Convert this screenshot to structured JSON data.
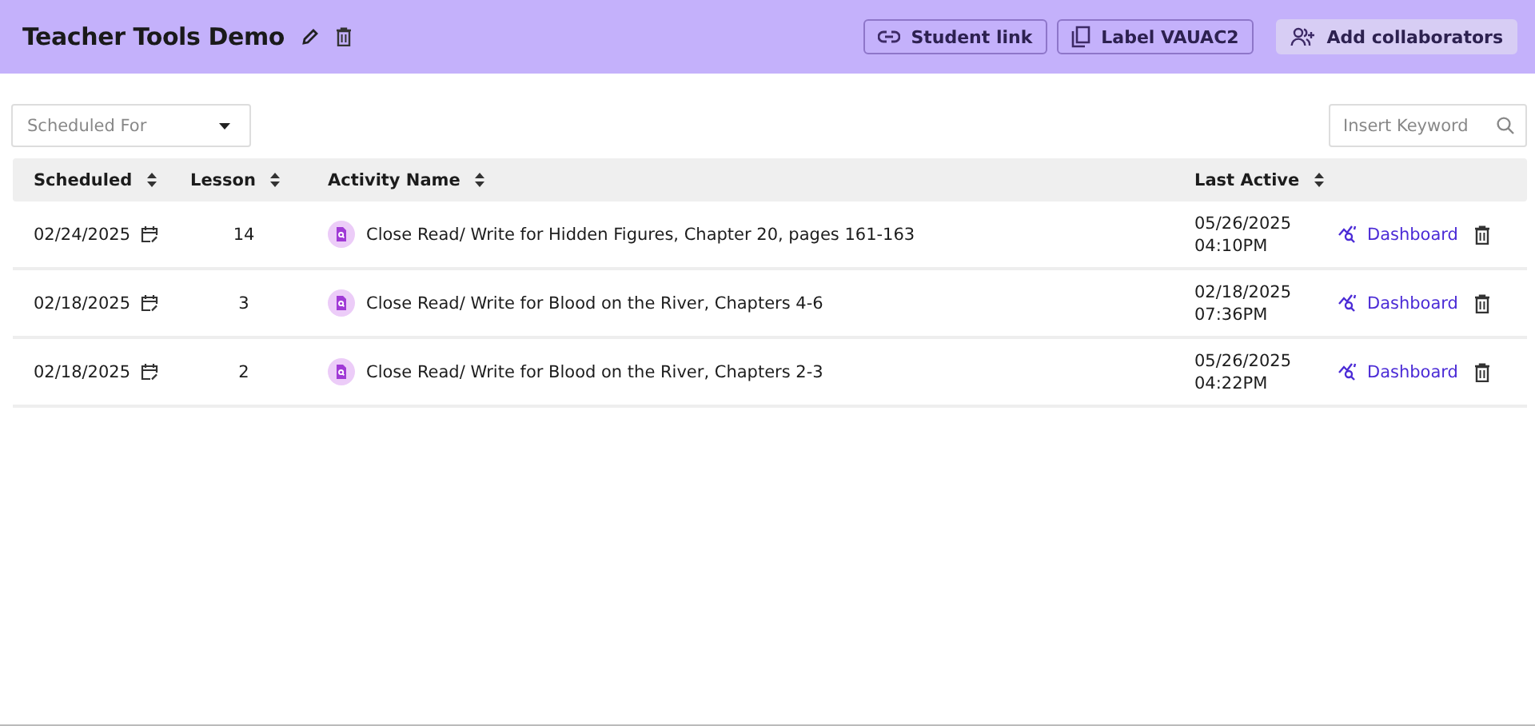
{
  "header": {
    "title": "Teacher Tools Demo",
    "buttons": [
      {
        "kind": "link",
        "label": "Student link"
      },
      {
        "kind": "copy",
        "label": "Label **VAUAC2**"
      },
      {
        "kind": "collab",
        "label": "Add collaborators"
      }
    ]
  },
  "filter": {
    "placeholder": "Scheduled For"
  },
  "search": {
    "placeholder": "Insert Keyword"
  },
  "table": {
    "columns": [
      "Scheduled",
      "Lesson",
      "Activity Name",
      "Last Active"
    ],
    "rows": [
      {
        "scheduled": "02/24/2025",
        "lesson": "14",
        "activity": "Close Read/ Write for Hidden Figures, Chapter 20, pages 161-163",
        "last_active": [
          "05/26/2025",
          "04:10PM"
        ],
        "action": "Dashboard"
      },
      {
        "scheduled": "02/18/2025",
        "lesson": "3",
        "activity": "Close Read/ Write for Blood on the River, Chapters 4-6",
        "last_active": [
          "02/18/2025",
          "07:36PM"
        ],
        "action": "Dashboard"
      },
      {
        "scheduled": "02/18/2025",
        "lesson": "2",
        "activity": "Close Read/ Write for Blood on the River, Chapters 2-3",
        "last_active": [
          "05/26/2025",
          "04:22PM"
        ],
        "action": "Dashboard"
      }
    ]
  }
}
